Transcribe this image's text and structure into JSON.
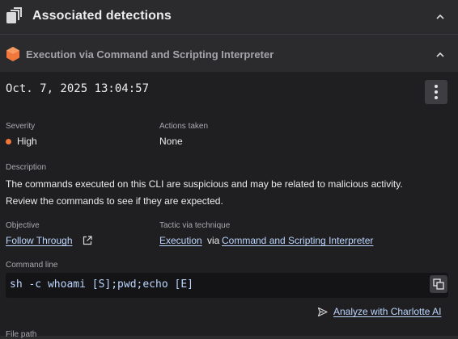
{
  "panel": {
    "title": "Associated detections",
    "icon": "stack-icon"
  },
  "detection": {
    "title": "Execution via Command and Scripting Interpreter",
    "icon": "hexagon-icon",
    "timestamp": "Oct. 7, 2025 13:04:57",
    "severity": {
      "label": "Severity",
      "value": "High",
      "color": "#f0773b"
    },
    "actions_taken": {
      "label": "Actions taken",
      "value": "None"
    },
    "description": {
      "label": "Description",
      "line1": "The commands executed on this CLI are suspicious and may be related to malicious activity.",
      "line2": "Review the commands to see if they are expected."
    },
    "objective": {
      "label": "Objective",
      "value": "Follow Through"
    },
    "tactic": {
      "label": "Tactic via technique",
      "tactic": "Execution",
      "via": "via",
      "technique": "Command and Scripting Interpreter"
    },
    "command_line": {
      "label": "Command line",
      "value": "sh -c whoami [S];pwd;echo [E]"
    },
    "analyze_label": "Analyze with Charlotte AI",
    "next_label": "File path"
  },
  "colors": {
    "background": "#2b2b2e",
    "content_background": "#1f1f21",
    "link": "#bcd6ff",
    "accent": "#f0773b"
  }
}
